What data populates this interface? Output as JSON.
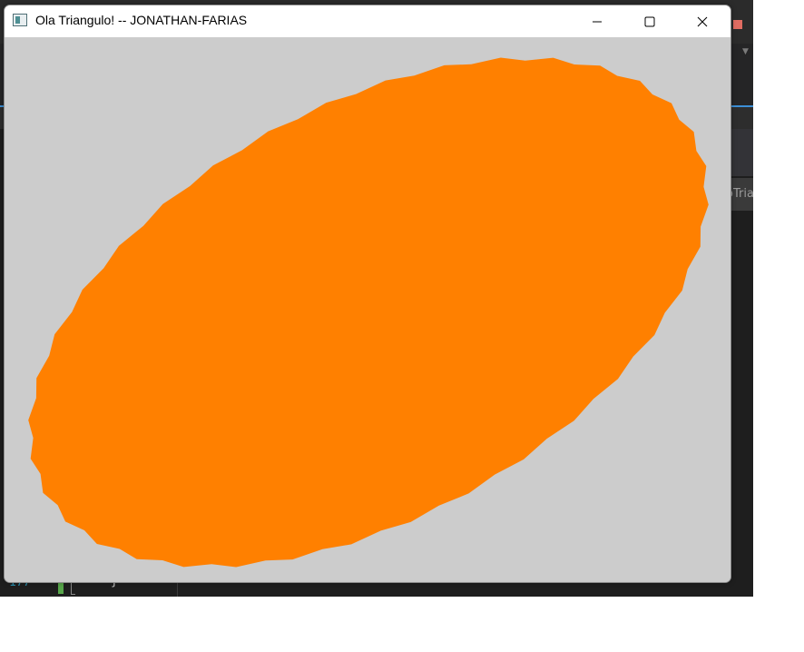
{
  "window": {
    "title": "Ola Triangulo! -- JONATHAN-FARIAS",
    "icon": "app-window-icon",
    "controls": [
      "minimize-icon",
      "maximize-icon",
      "close-icon"
    ]
  },
  "canvas": {
    "background": "#cccccc",
    "shape": "ellipse",
    "fill": "#ff8000"
  },
  "background_editor": {
    "tab_fragment": "oTria",
    "line_number": "177",
    "code_fragment": "}"
  }
}
